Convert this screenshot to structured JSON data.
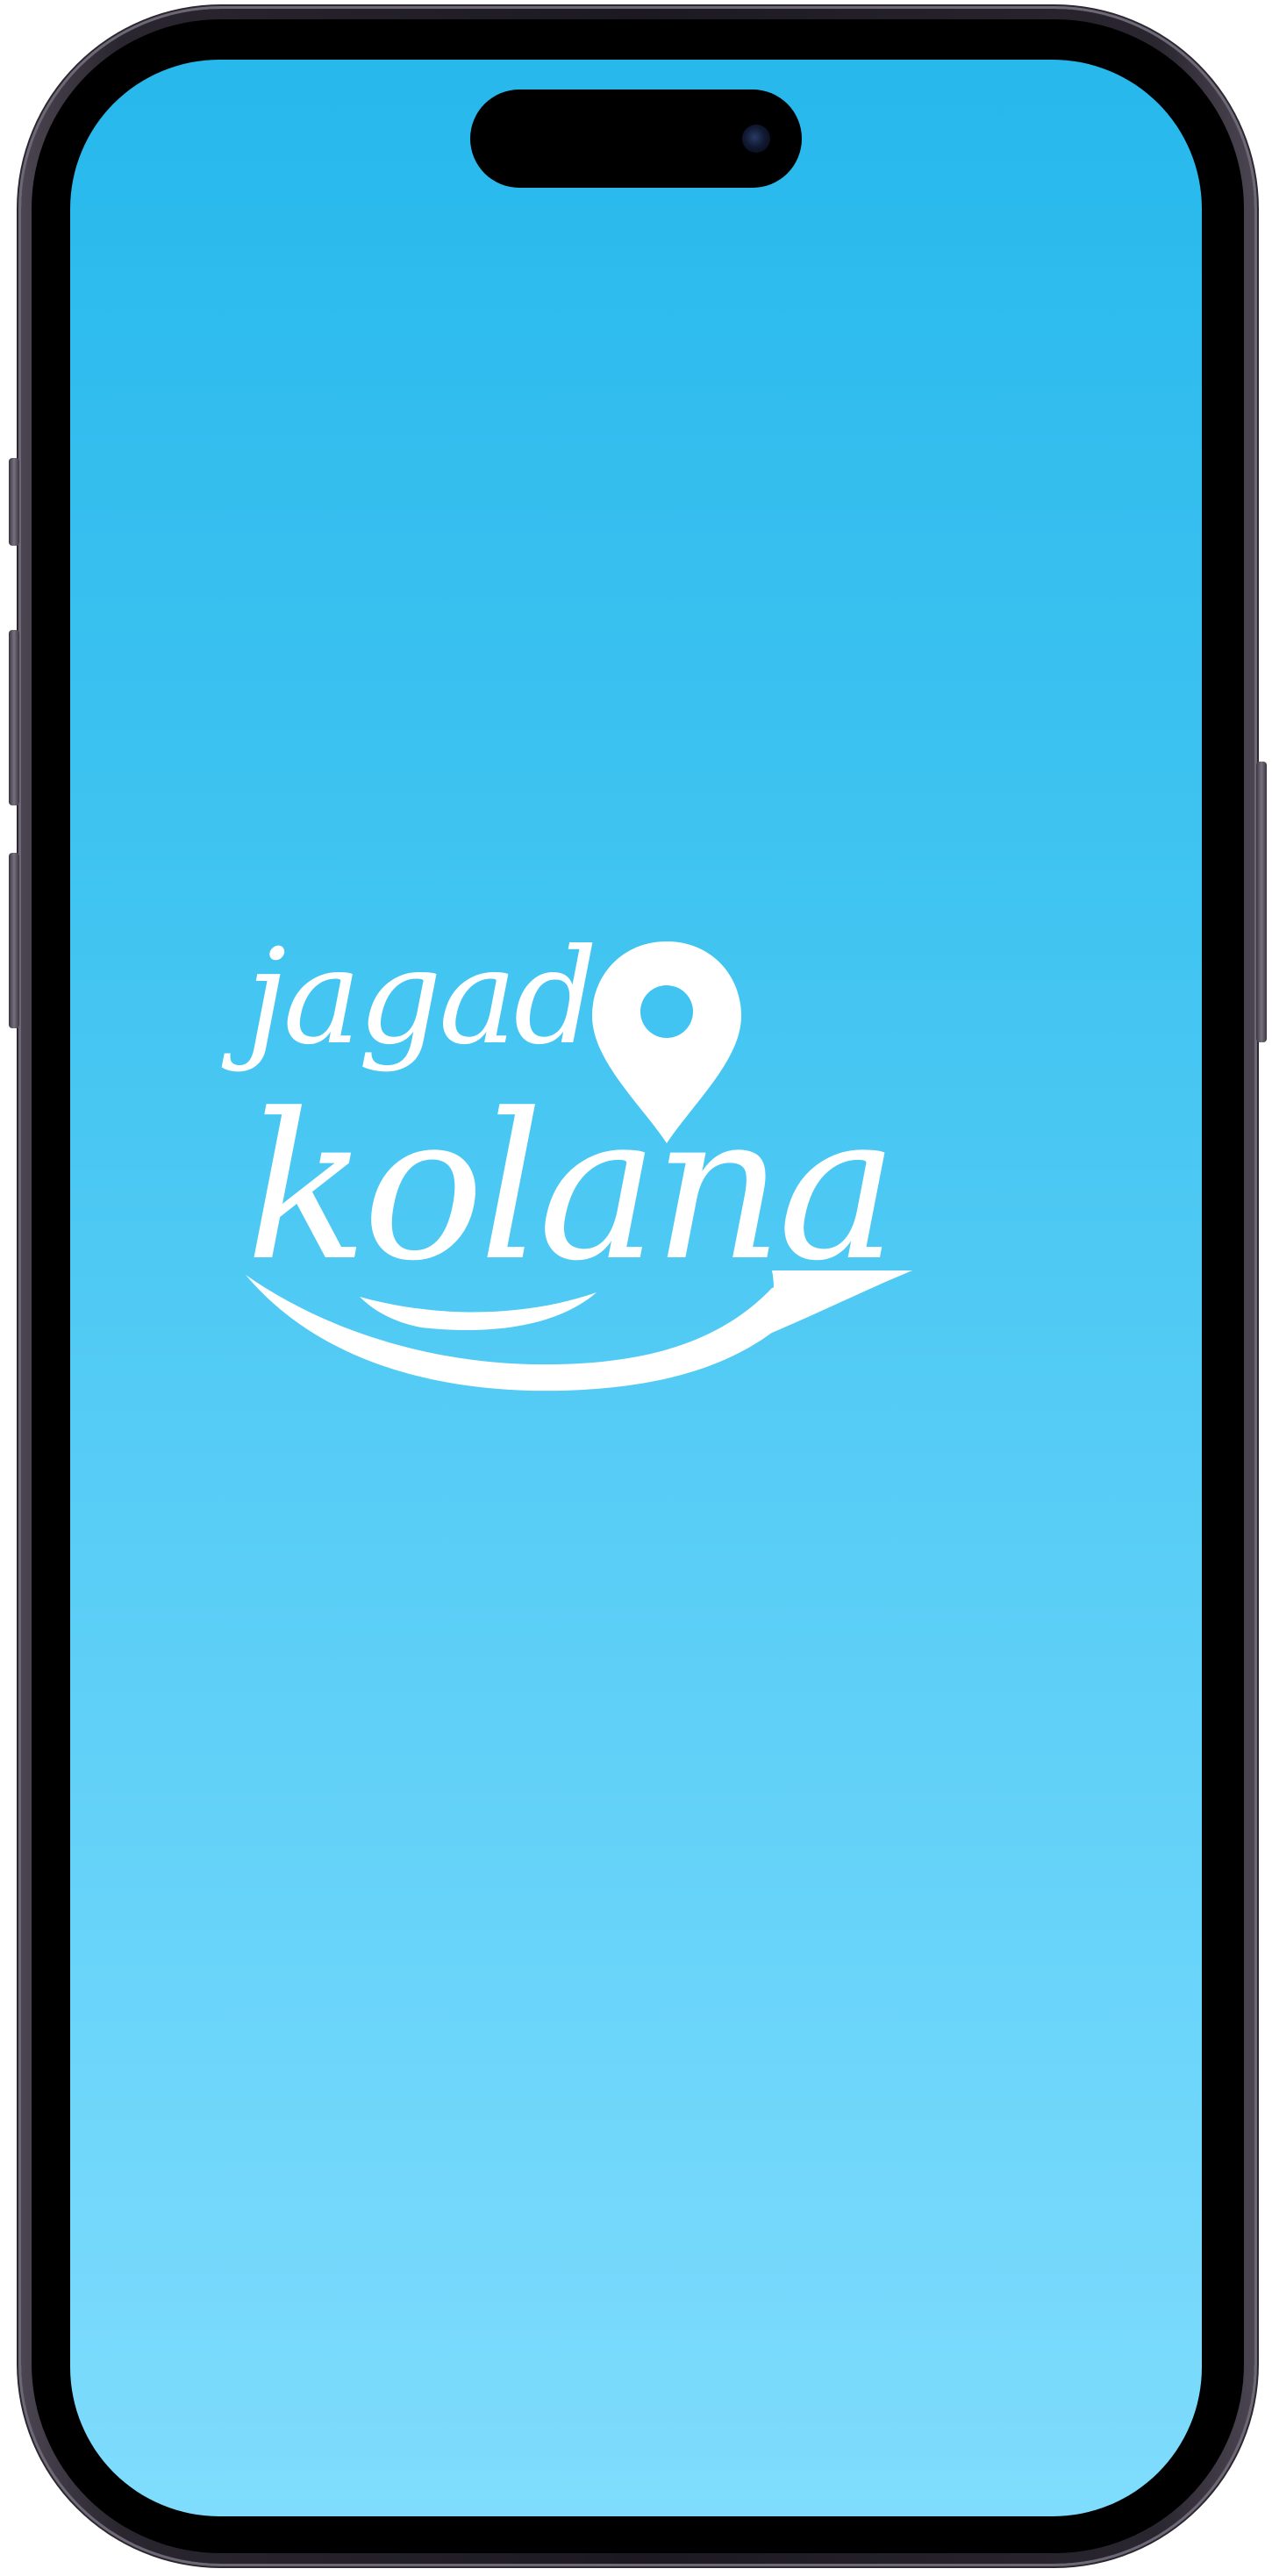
{
  "device": {
    "model": "phone",
    "frame_color": "#2a2630"
  },
  "screen": {
    "background_top": "#27b8ec",
    "background_bottom": "#7fdcfd"
  },
  "logo": {
    "line1": "jagad",
    "line2": "kolana",
    "color": "#ffffff",
    "pin_icon": "location-pin-icon",
    "swoosh": "swoosh-graphic"
  }
}
